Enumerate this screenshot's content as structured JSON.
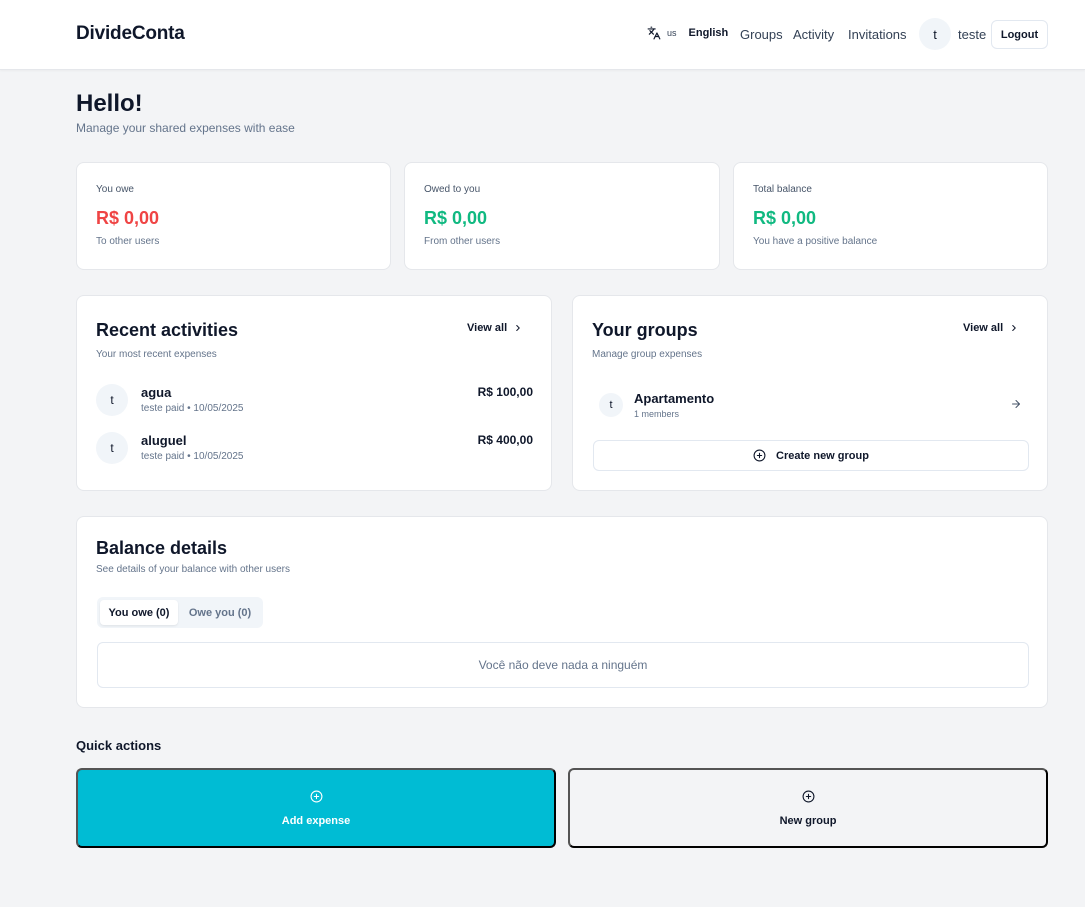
{
  "header": {
    "brand": "DivideConta",
    "lang_code": "us",
    "lang_name": "English",
    "nav": [
      "Groups",
      "Activity",
      "Invitations"
    ],
    "avatar_initial": "t",
    "username": "teste",
    "logout_label": "Logout"
  },
  "welcome": {
    "title": "Hello!",
    "subtitle": "Manage your shared expenses with ease"
  },
  "stats": [
    {
      "label": "You owe",
      "value": "R$ 0,00",
      "sub": "To other users",
      "color": "#ef4444"
    },
    {
      "label": "Owed to you",
      "value": "R$ 0,00",
      "sub": "From other users",
      "color": "#10b981"
    },
    {
      "label": "Total balance",
      "value": "R$ 0,00",
      "sub": "You have a positive balance",
      "color": "#10b981"
    }
  ],
  "recent": {
    "title": "Recent activities",
    "subtitle": "Your most recent expenses",
    "view_all": "View all",
    "items": [
      {
        "initial": "t",
        "title": "agua",
        "meta": "teste paid • 10/05/2025",
        "amount": "R$ 100,00"
      },
      {
        "initial": "t",
        "title": "aluguel",
        "meta": "teste paid • 10/05/2025",
        "amount": "R$ 400,00"
      }
    ]
  },
  "groups": {
    "title": "Your groups",
    "subtitle": "Manage group expenses",
    "view_all": "View all",
    "items": [
      {
        "initial": "t",
        "name": "Apartamento",
        "members": "1 members"
      }
    ],
    "create_label": "Create new group"
  },
  "balance": {
    "title": "Balance details",
    "subtitle": "See details of your balance with other users",
    "tabs": [
      "You owe (0)",
      "Owe you (0)"
    ],
    "empty": "Você não deve nada a ninguém"
  },
  "quick_actions": {
    "title": "Quick actions",
    "add_expense": "Add expense",
    "new_group": "New group"
  },
  "colors": {
    "accent": "#00bcd4",
    "negative": "#ef4444",
    "positive": "#10b981"
  }
}
